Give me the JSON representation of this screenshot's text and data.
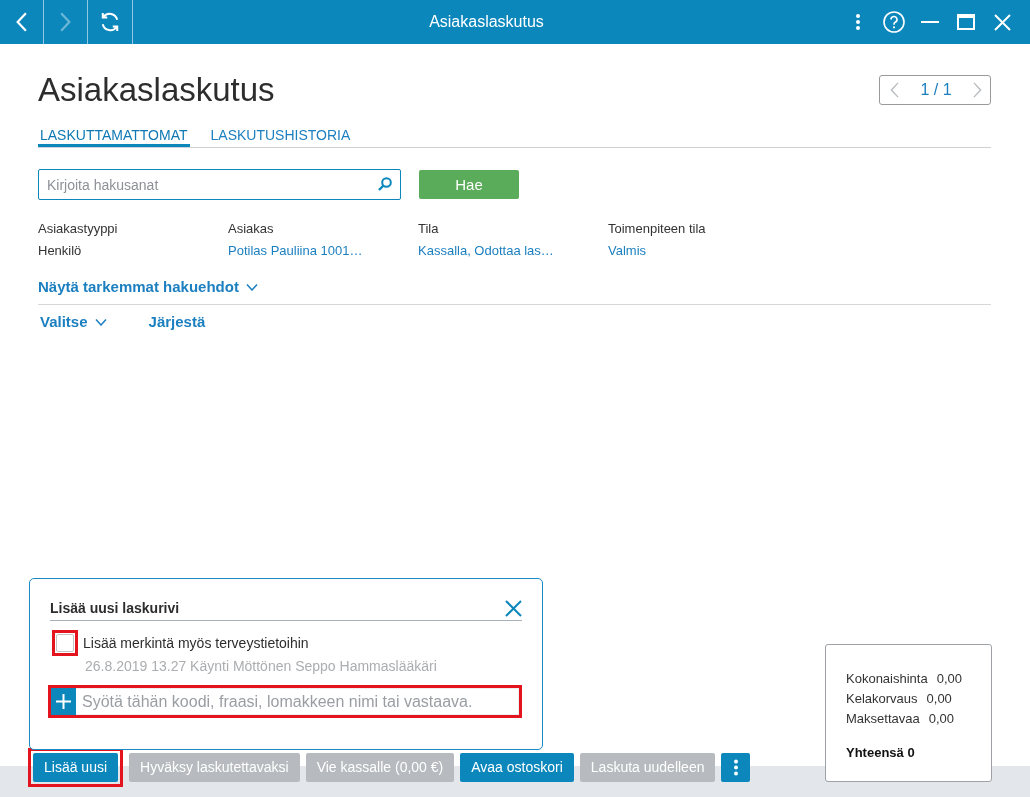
{
  "title_bar": {
    "title": "Asiakaslaskutus",
    "back_disabled": false,
    "forward_disabled": true
  },
  "header": {
    "title": "Asiakaslaskutus",
    "pager": {
      "text": "1 / 1",
      "prev_disabled": true,
      "next_disabled": true
    }
  },
  "tabs": [
    {
      "label": "LASKUTTAMATTOMAT",
      "selected": true
    },
    {
      "label": "LASKUTUSHISTORIA",
      "selected": false
    }
  ],
  "search": {
    "placeholder": "Kirjoita hakusanat",
    "button": "Hae"
  },
  "filters": [
    {
      "label": "Asiakastyyppi",
      "value": "Henkilö",
      "kind": "text"
    },
    {
      "label": "Asiakas",
      "value": "Potilas Pauliina 1001…",
      "kind": "link"
    },
    {
      "label": "Tila",
      "value": "Kassalla, Odottaa las…",
      "kind": "link"
    },
    {
      "label": "Toimenpiteen tila",
      "value": "Valmis",
      "kind": "link"
    }
  ],
  "more_filters": {
    "label": "Näytä tarkemmat hakuehdot",
    "expanded": false
  },
  "list_actions": [
    {
      "label": "Valitse",
      "kind": "dropdown"
    },
    {
      "label": "Järjestä",
      "kind": "link"
    }
  ],
  "add_row_panel": {
    "title": "Lisää uusi laskurivi",
    "checkbox": {
      "label": "Lisää merkintä myös terveystietoihin",
      "checked": false,
      "highlighted": true
    },
    "visit": "26.8.2019 13.27 Käynti Möttönen Seppo Hammaslääkäri",
    "input": {
      "placeholder": "Syötä tähän koodi, fraasi, lomakkeen nimi tai vastaava.",
      "highlighted": true
    }
  },
  "summary": {
    "rows": [
      {
        "label": "Kokonaishinta",
        "value": "0,00"
      },
      {
        "label": "Kelakorvaus",
        "value": "0,00"
      },
      {
        "label": "Maksettavaa",
        "value": "0,00"
      }
    ],
    "total": "Yhteensä 0"
  },
  "actions": [
    {
      "label": "Lisää uusi",
      "disabled": false,
      "highlighted": true
    },
    {
      "label": "Hyväksy laskutettavaksi",
      "disabled": true,
      "highlighted": false
    },
    {
      "label": "Vie kassalle (0,00 €)",
      "disabled": true,
      "highlighted": false
    },
    {
      "label": "Avaa ostoskori",
      "disabled": false,
      "highlighted": false
    },
    {
      "label": "Laskuta uudelleen",
      "disabled": true,
      "highlighted": false
    }
  ]
}
